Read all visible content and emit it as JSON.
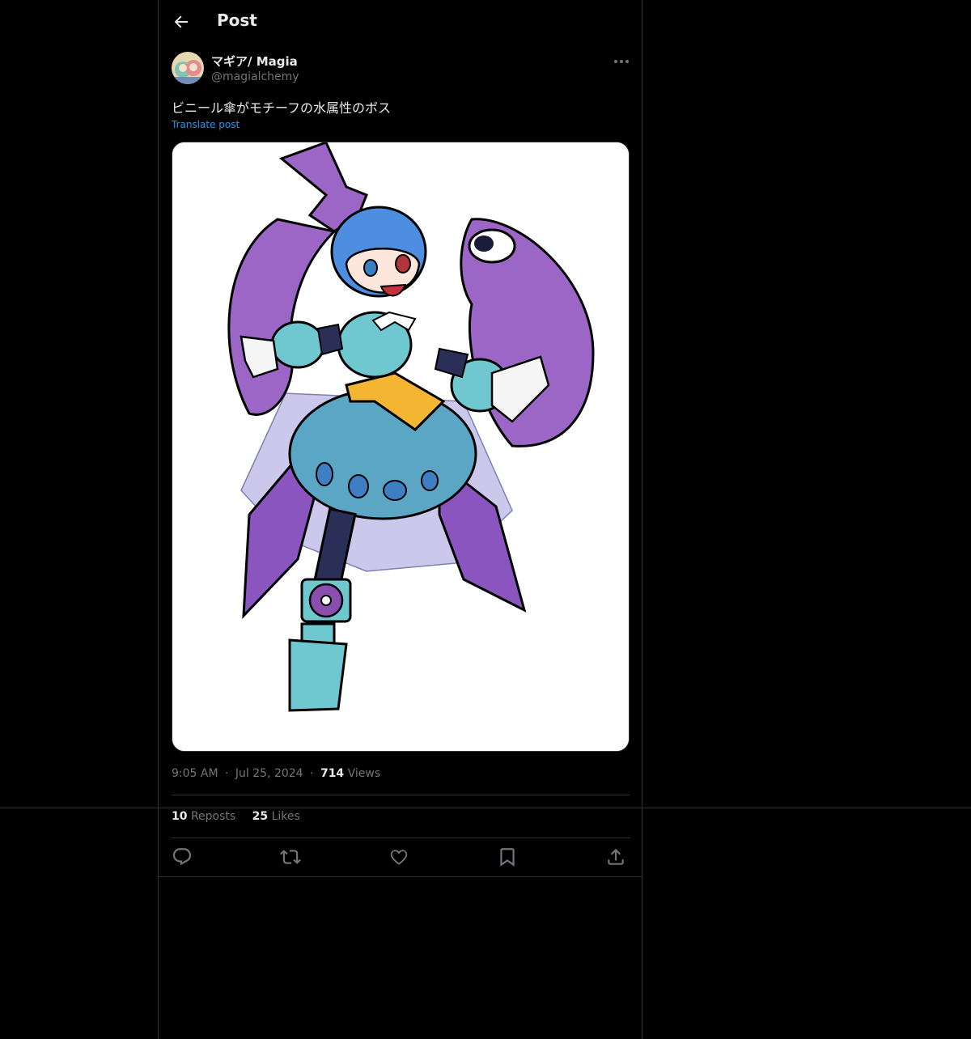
{
  "header": {
    "title": "Post",
    "back_icon": "arrow-left-icon"
  },
  "post": {
    "display_name": "マギア/ Magia",
    "handle": "@magialchemy",
    "text": "ビニール傘がモチーフの水属性のボス",
    "translate_label": "Translate post",
    "time": "9:05 AM",
    "date": "Jul 25, 2024",
    "dot": "·",
    "views_count": "714",
    "views_label": "Views"
  },
  "stats": {
    "reposts_count": "10",
    "reposts_label": "Reposts",
    "likes_count": "25",
    "likes_label": "Likes"
  },
  "actions": [
    "reply-icon",
    "repost-icon",
    "like-icon",
    "bookmark-icon",
    "share-icon"
  ],
  "colors": {
    "background": "#000000",
    "border": "#2f3336",
    "text": "#e7e9ea",
    "muted": "#71767b",
    "link": "#1d9bf0"
  }
}
